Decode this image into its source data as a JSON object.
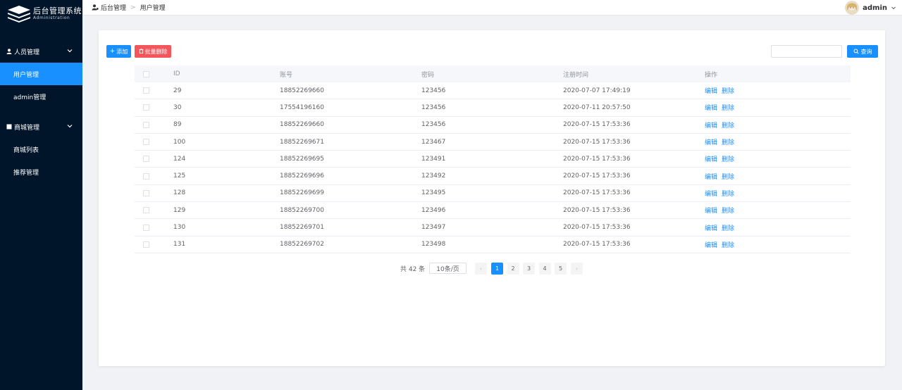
{
  "sidebar": {
    "logo_title": "后台管理系统",
    "logo_subtitle": "Administration",
    "groups": [
      {
        "label": "人员管理",
        "items": [
          {
            "label": "用户管理",
            "active": true
          },
          {
            "label": "admin管理"
          }
        ]
      },
      {
        "label": "商城管理",
        "items": [
          {
            "label": "商城列表"
          },
          {
            "label": "推荐管理"
          }
        ]
      }
    ]
  },
  "header": {
    "breadcrumb": [
      "后台管理",
      "用户管理"
    ],
    "breadcrumb_sep": ">",
    "username": "admin"
  },
  "toolbar": {
    "add_label": "添加",
    "add_icon": "+",
    "batch_delete_label": "批量删除",
    "batch_delete_icon": "🗑",
    "search_placeholder": "",
    "search_label": "查询"
  },
  "table": {
    "columns": [
      "ID",
      "账号",
      "密码",
      "注册时间",
      "操作"
    ],
    "actions": [
      "编辑",
      "删除"
    ],
    "rows": [
      {
        "id": "29",
        "account": "18852269660",
        "password": "123456",
        "time": "2020-07-07 17:49:19"
      },
      {
        "id": "30",
        "account": "17554196160",
        "password": "123456",
        "time": "2020-07-11 20:57:50"
      },
      {
        "id": "89",
        "account": "18852269660",
        "password": "123456",
        "time": "2020-07-15 17:53:36"
      },
      {
        "id": "100",
        "account": "18852269671",
        "password": "123467",
        "time": "2020-07-15 17:53:36"
      },
      {
        "id": "124",
        "account": "18852269695",
        "password": "123491",
        "time": "2020-07-15 17:53:36"
      },
      {
        "id": "125",
        "account": "18852269696",
        "password": "123492",
        "time": "2020-07-15 17:53:36"
      },
      {
        "id": "128",
        "account": "18852269699",
        "password": "123495",
        "time": "2020-07-15 17:53:36"
      },
      {
        "id": "129",
        "account": "18852269700",
        "password": "123496",
        "time": "2020-07-15 17:53:36"
      },
      {
        "id": "130",
        "account": "18852269701",
        "password": "123497",
        "time": "2020-07-15 17:53:36"
      },
      {
        "id": "131",
        "account": "18852269702",
        "password": "123498",
        "time": "2020-07-15 17:53:36"
      }
    ]
  },
  "pagination": {
    "total_label": "共 42 条",
    "page_size_label": "10条/页",
    "prev_label": "‹",
    "next_label": "›",
    "pages": [
      "1",
      "2",
      "3",
      "4",
      "5"
    ],
    "current_page": "1"
  },
  "colors": {
    "sidebar_bg": "#001529",
    "primary": "#1890ff",
    "danger": "#f5565c"
  }
}
